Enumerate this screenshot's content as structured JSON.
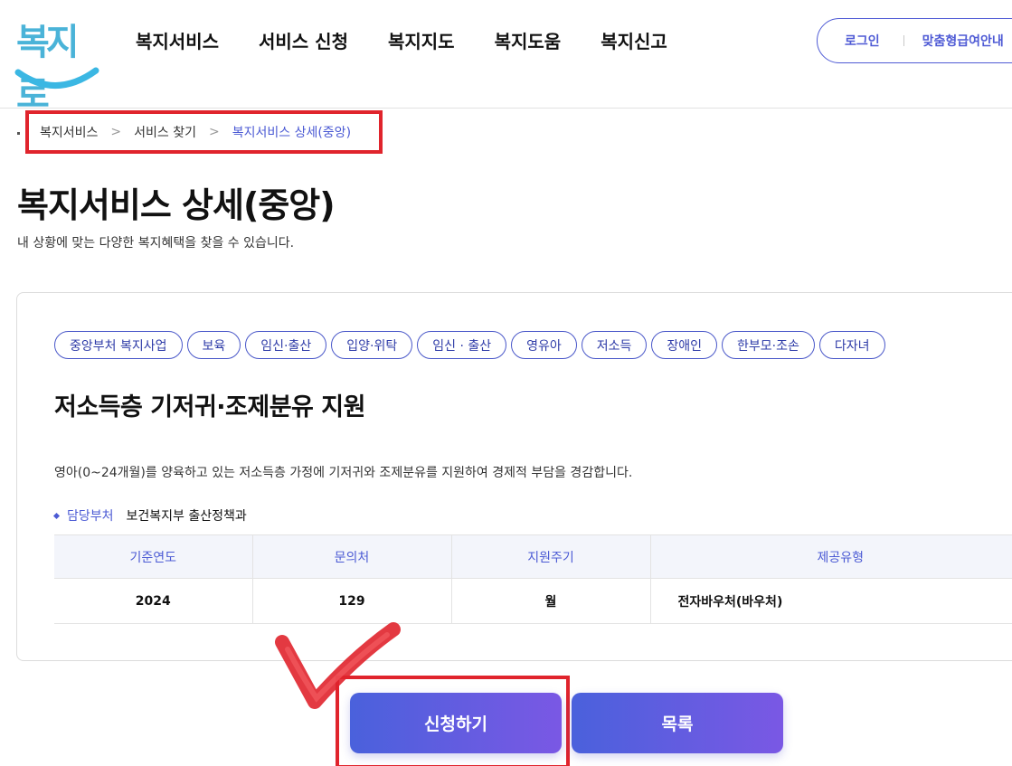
{
  "header": {
    "logo_text": "복지로",
    "nav": [
      "복지서비스",
      "서비스 신청",
      "복지지도",
      "복지도움",
      "복지신고"
    ],
    "login_label": "로그인",
    "custom_guide_label": "맞춤형급여안내"
  },
  "breadcrumb": [
    "복지서비스",
    "서비스 찾기",
    "복지서비스 상세(중앙)"
  ],
  "page": {
    "title": "복지서비스 상세(중앙)",
    "description": "내 상황에 맞는 다양한 복지혜택을 찾을 수 있습니다."
  },
  "service": {
    "tags": [
      "중앙부처 복지사업",
      "보육",
      "임신·출산",
      "입양·위탁",
      "임신 · 출산",
      "영유아",
      "저소득",
      "장애인",
      "한부모·조손",
      "다자녀"
    ],
    "title": "저소득층 기저귀·조제분유 지원",
    "description": "영아(0~24개월)를 양육하고 있는 저소득층 가정에 기저귀와 조제분유를 지원하여 경제적 부담을 경감합니다.",
    "dept_label": "담당부처",
    "dept_value": "보건복지부 출산정책과",
    "table": {
      "headers": [
        "기준연도",
        "문의처",
        "지원주기",
        "제공유형"
      ],
      "row": [
        "2024",
        "129",
        "월",
        "전자바우처(바우처)"
      ]
    }
  },
  "buttons": {
    "apply": "신청하기",
    "list": "목록"
  },
  "colors": {
    "accent": "#4b5ad4",
    "highlight_frame": "#e0242c",
    "button_gradient_start": "#4a61dc",
    "button_gradient_end": "#7a58e4",
    "logo": "#4ab3d8"
  }
}
